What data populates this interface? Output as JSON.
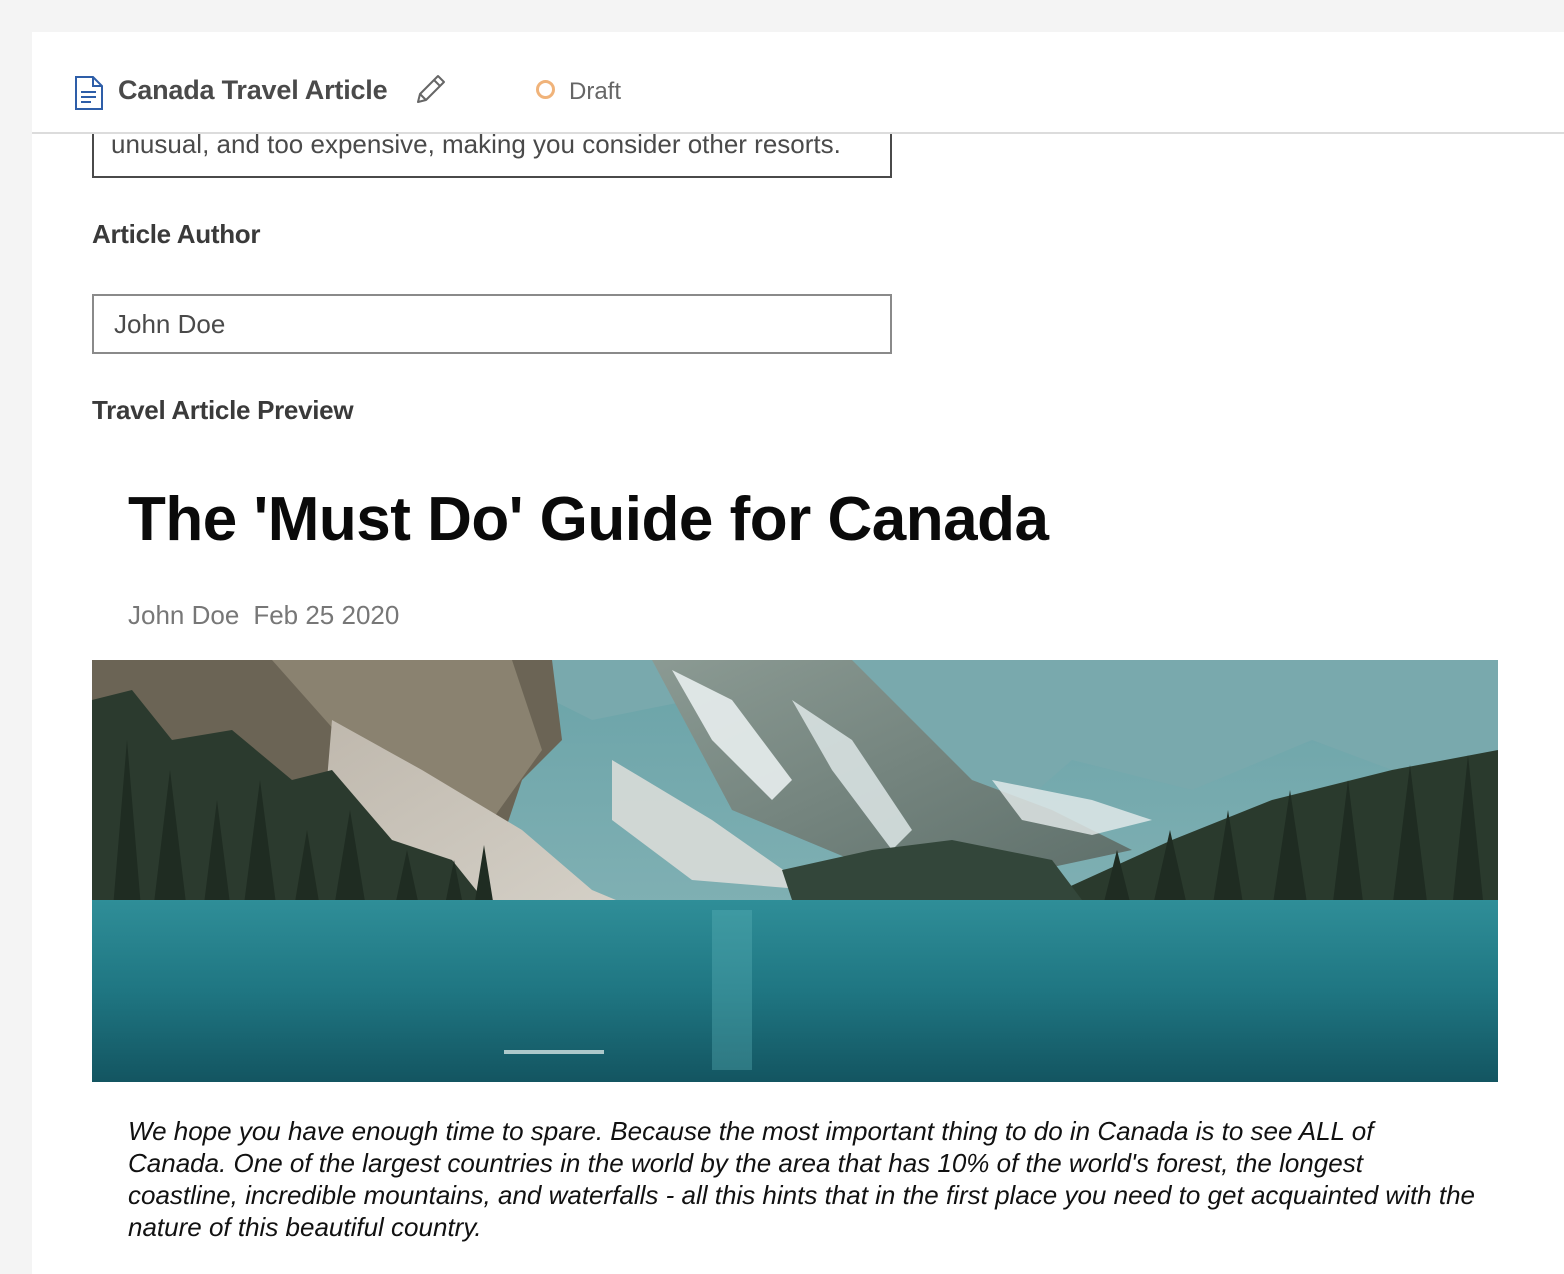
{
  "header": {
    "doc_icon": "document-icon",
    "title": "Canada Travel Article",
    "edit_icon": "pencil-icon",
    "status": "Draft",
    "status_color": "#f0b37a"
  },
  "form": {
    "summary_visible_text": "unusual, and too expensive, making you consider other resorts.",
    "author_label": "Article Author",
    "author_value": "John Doe",
    "preview_label": "Travel Article Preview"
  },
  "preview": {
    "title": "The 'Must Do' Guide for Canada",
    "author": "John Doe",
    "date": "Feb 25 2020",
    "image": "mountain-lake-photo",
    "body": "We hope you have enough time to spare. Because the most important thing to do in Canada is to see ALL of Canada. One of the largest countries in the world by the area that has 10% of the world's forest, the longest coastline, incredible mountains, and waterfalls - all this hints that in the first place you need to get acquainted with the nature of this beautiful country."
  }
}
